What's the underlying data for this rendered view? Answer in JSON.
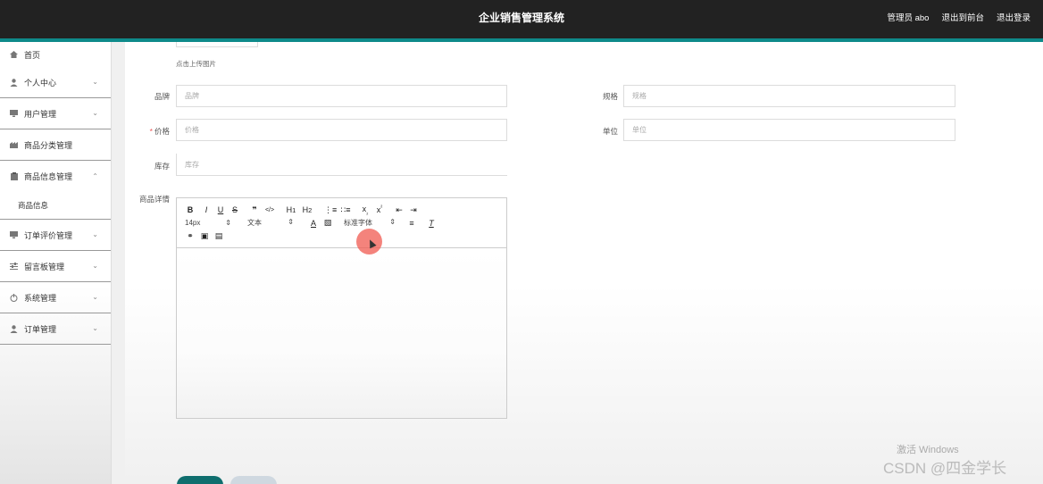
{
  "header": {
    "title": "企业销售管理系统",
    "user_label": "管理员 abo",
    "back_to_front": "退出到前台",
    "logout": "退出登录"
  },
  "sidebar": {
    "items": [
      {
        "label": "首页",
        "icon": "home-icon"
      },
      {
        "label": "个人中心",
        "icon": "person-icon"
      },
      {
        "label": "用户管理",
        "icon": "monitor-icon"
      },
      {
        "label": "商品分类管理",
        "icon": "factory-icon"
      },
      {
        "label": "商品信息管理",
        "icon": "clipboard-icon"
      },
      {
        "label": "订单评价管理",
        "icon": "monitor-icon"
      },
      {
        "label": "留言板管理",
        "icon": "sliders-icon"
      },
      {
        "label": "系统管理",
        "icon": "power-icon"
      },
      {
        "label": "订单管理",
        "icon": "person-icon"
      }
    ],
    "submenu_label": "商品信息"
  },
  "form": {
    "upload_hint": "点击上传图片",
    "brand_label": "品牌",
    "brand_placeholder": "品牌",
    "spec_label": "规格",
    "spec_placeholder": "规格",
    "price_required": "*",
    "price_label": "价格",
    "price_placeholder": "价格",
    "unit_label": "单位",
    "unit_placeholder": "单位",
    "stock_label": "库存",
    "stock_placeholder": "库存",
    "details_label": "商品详情"
  },
  "editor": {
    "font_size": "14px",
    "header_select": "文本",
    "font_family": "标准字体"
  },
  "watermarks": {
    "windows": "激活 Windows",
    "csdn": "CSDN @四金学长"
  },
  "colors": {
    "topbar": "#222222",
    "accent": "#0e8a8a",
    "save_button": "#0f6e6e",
    "cursor_highlight": "#f05a50"
  }
}
